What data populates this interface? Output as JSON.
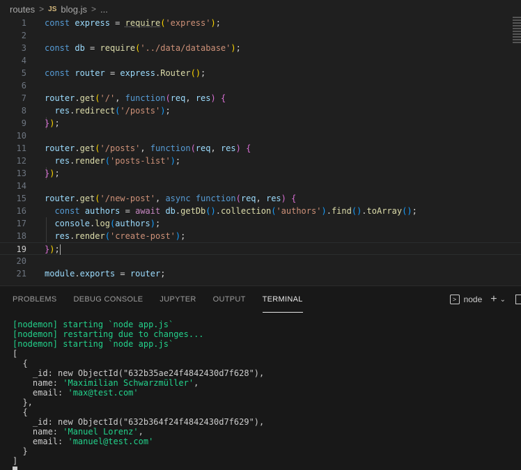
{
  "breadcrumb": {
    "folder": "routes",
    "file_badge": "JS",
    "file": "blog.js",
    "more": "..."
  },
  "editor": {
    "line_numbers": [
      "1",
      "2",
      "3",
      "4",
      "5",
      "6",
      "7",
      "8",
      "9",
      "10",
      "11",
      "12",
      "13",
      "14",
      "15",
      "16",
      "17",
      "18",
      "19",
      "20",
      "21"
    ],
    "current_line": "19"
  },
  "tabs": {
    "problems": "PROBLEMS",
    "debug": "DEBUG CONSOLE",
    "jupyter": "JUPYTER",
    "output": "OUTPUT",
    "terminal": "TERMINAL"
  },
  "terminal_panel": {
    "shell": "node",
    "plus": "+",
    "chevron": "⌄"
  },
  "terminal": {
    "line1": "[nodemon] starting `node app.js`",
    "line2": "[nodemon] restarting due to changes...",
    "line3": "[nodemon] starting `node app.js`",
    "open_bracket": "[",
    "close_bracket": "]",
    "obj_open": "{",
    "obj_close_comma": "},",
    "obj_close": "}",
    "entries": [
      {
        "id_line": "_id: new ObjectId(\"632b35ae24f4842430d7f628\"),",
        "name_key": "name: ",
        "name_val": "'Maximilian Schwarzmüller'",
        "email_key": "email: ",
        "email_val": "'max@test.com'"
      },
      {
        "id_line": "_id: new ObjectId(\"632b364f24f4842430d7f629\"),",
        "name_key": "name: ",
        "name_val": "'Manuel Lorenz'",
        "email_key": "email: ",
        "email_val": "'manuel@test.com'"
      }
    ]
  }
}
